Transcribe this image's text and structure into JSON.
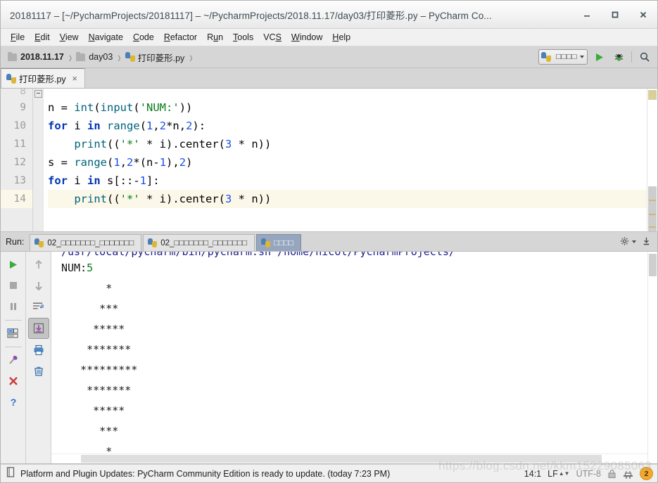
{
  "window": {
    "title": "20181117 – [~/PycharmProjects/20181117] – ~/PycharmProjects/2018.11.17/day03/打印菱形.py – PyCharm Co...",
    "minimize_label": "–",
    "maximize_label": "□",
    "close_label": "✕"
  },
  "menubar": {
    "items": [
      {
        "label": "File",
        "mnemonic": "F"
      },
      {
        "label": "Edit",
        "mnemonic": "E"
      },
      {
        "label": "View",
        "mnemonic": "V"
      },
      {
        "label": "Navigate",
        "mnemonic": "N"
      },
      {
        "label": "Code",
        "mnemonic": "C"
      },
      {
        "label": "Refactor",
        "mnemonic": "R"
      },
      {
        "label": "Run",
        "mnemonic": "u"
      },
      {
        "label": "Tools",
        "mnemonic": "T"
      },
      {
        "label": "VCS",
        "mnemonic": "S"
      },
      {
        "label": "Window",
        "mnemonic": "W"
      },
      {
        "label": "Help",
        "mnemonic": "H"
      }
    ]
  },
  "breadcrumb": {
    "items": [
      {
        "label": "2018.11.17",
        "icon": "folder-icon",
        "bold": true
      },
      {
        "label": "day03",
        "icon": "folder-icon",
        "bold": false
      },
      {
        "label": "打印菱形.py",
        "icon": "python-file-icon",
        "bold": false
      }
    ],
    "separator": "›"
  },
  "toolbar": {
    "run_config_label": "□□□□",
    "run_config_icon": "python-icon",
    "run_button": "run-icon",
    "debug_button": "debug-icon",
    "search_button": "search-icon"
  },
  "editor_tabs": [
    {
      "label": "打印菱形.py",
      "icon": "python-file-icon",
      "close": "×",
      "active": true
    }
  ],
  "editor": {
    "first_visible_line": 8,
    "current_line": 14,
    "cursor_position": "14:1",
    "lines": [
      {
        "num": 9,
        "current": false,
        "tokens": [
          {
            "t": "n = ",
            "c": "plain"
          },
          {
            "t": "int",
            "c": "fn"
          },
          {
            "t": "(",
            "c": "plain"
          },
          {
            "t": "input",
            "c": "fn"
          },
          {
            "t": "(",
            "c": "plain"
          },
          {
            "t": "'NUM:'",
            "c": "str"
          },
          {
            "t": "))",
            "c": "plain"
          }
        ]
      },
      {
        "num": 10,
        "current": false,
        "tokens": [
          {
            "t": "for",
            "c": "kw"
          },
          {
            "t": " i ",
            "c": "plain"
          },
          {
            "t": "in",
            "c": "kw"
          },
          {
            "t": " ",
            "c": "plain"
          },
          {
            "t": "range",
            "c": "fn"
          },
          {
            "t": "(",
            "c": "plain"
          },
          {
            "t": "1",
            "c": "num"
          },
          {
            "t": ",",
            "c": "plain"
          },
          {
            "t": "2",
            "c": "num"
          },
          {
            "t": "*n,",
            "c": "plain"
          },
          {
            "t": "2",
            "c": "num"
          },
          {
            "t": "):",
            "c": "plain"
          }
        ]
      },
      {
        "num": 11,
        "current": false,
        "tokens": [
          {
            "t": "    ",
            "c": "plain"
          },
          {
            "t": "print",
            "c": "fn"
          },
          {
            "t": "((",
            "c": "plain"
          },
          {
            "t": "'*'",
            "c": "str"
          },
          {
            "t": " * i).center(",
            "c": "plain"
          },
          {
            "t": "3",
            "c": "num"
          },
          {
            "t": " * n))",
            "c": "plain"
          }
        ]
      },
      {
        "num": 12,
        "current": false,
        "tokens": [
          {
            "t": "s = ",
            "c": "plain"
          },
          {
            "t": "range",
            "c": "fn"
          },
          {
            "t": "(",
            "c": "plain"
          },
          {
            "t": "1",
            "c": "num"
          },
          {
            "t": ",",
            "c": "plain"
          },
          {
            "t": "2",
            "c": "num"
          },
          {
            "t": "*(n-",
            "c": "plain"
          },
          {
            "t": "1",
            "c": "num"
          },
          {
            "t": "),",
            "c": "plain"
          },
          {
            "t": "2",
            "c": "num"
          },
          {
            "t": ")",
            "c": "plain"
          }
        ]
      },
      {
        "num": 13,
        "current": false,
        "tokens": [
          {
            "t": "for",
            "c": "kw"
          },
          {
            "t": " i ",
            "c": "plain"
          },
          {
            "t": "in",
            "c": "kw"
          },
          {
            "t": " s[::-",
            "c": "plain"
          },
          {
            "t": "1",
            "c": "num"
          },
          {
            "t": "]:",
            "c": "plain"
          }
        ]
      },
      {
        "num": 14,
        "current": true,
        "tokens": [
          {
            "t": "    ",
            "c": "plain"
          },
          {
            "t": "print",
            "c": "fn"
          },
          {
            "t": "((",
            "c": "plain"
          },
          {
            "t": "'*'",
            "c": "str"
          },
          {
            "t": " * i).center(",
            "c": "plain"
          },
          {
            "t": "3",
            "c": "num"
          },
          {
            "t": " * n))",
            "c": "plain"
          }
        ]
      }
    ]
  },
  "run_panel": {
    "label": "Run:",
    "tabs": [
      {
        "label": "02_□□□□□□□_□□□□□□□",
        "icon": "python-icon",
        "active": false
      },
      {
        "label": "02_□□□□□□□_□□□□□□□",
        "icon": "python-icon",
        "active": false
      },
      {
        "label": "□□□□",
        "icon": "python-icon",
        "active": true
      }
    ],
    "settings_icon": "gear-icon",
    "hide_icon": "hide-panel-icon",
    "left_toolbar": [
      {
        "name": "rerun-icon",
        "title": "Rerun"
      },
      {
        "name": "stop-icon",
        "title": "Stop"
      },
      {
        "name": "pause-icon",
        "title": "Pause Output"
      },
      {
        "name": "console-view-icon",
        "title": "Console"
      },
      {
        "name": "pin-tab-icon",
        "title": "Pin Tab"
      },
      {
        "name": "close-icon",
        "title": "Close"
      },
      {
        "name": "help-icon",
        "title": "Help"
      }
    ],
    "right_toolbar": [
      {
        "name": "arrow-up-icon",
        "title": "Up the stack trace"
      },
      {
        "name": "arrow-down-icon",
        "title": "Down the stack trace"
      },
      {
        "name": "soft-wrap-icon",
        "title": "Use Soft Wraps"
      },
      {
        "name": "scroll-to-end-icon",
        "title": "Scroll to the end",
        "selected": true
      },
      {
        "name": "print-icon",
        "title": "Print"
      },
      {
        "name": "clear-all-icon",
        "title": "Clear All"
      }
    ]
  },
  "console": {
    "command_line": "/usr/local/pycharm/bin/pycharm.sh /home/nicol/PycharmProjects/",
    "prompt": "NUM:",
    "input_value": "5",
    "diamond_rows": [
      "       *       ",
      "      ***      ",
      "     *****     ",
      "    *******    ",
      "   *********   ",
      "    *******    ",
      "     *****     ",
      "      ***      ",
      "       *       "
    ]
  },
  "statusbar": {
    "message": "Platform and Plugin Updates: PyCharm Community Edition is ready to update. (today 7:23 PM)",
    "message_icon": "update-icon",
    "caret": "14:1",
    "line_separator": "LF",
    "encoding": "UTF-8",
    "lock_icon": "lock-icon",
    "inspections_icon": "inspection-icon",
    "notification_count": "2"
  },
  "watermark": {
    "text": "https://blog.csdn.net/kkm15229085063"
  },
  "colors": {
    "keyword": "#0033b3",
    "number": "#1750eb",
    "string": "#067d17",
    "function": "#00627a",
    "current_line": "#fbf8e9",
    "run_tab_active": "#97a6bf",
    "console_input": "#0a7a1d",
    "badge": "#f0a830"
  }
}
